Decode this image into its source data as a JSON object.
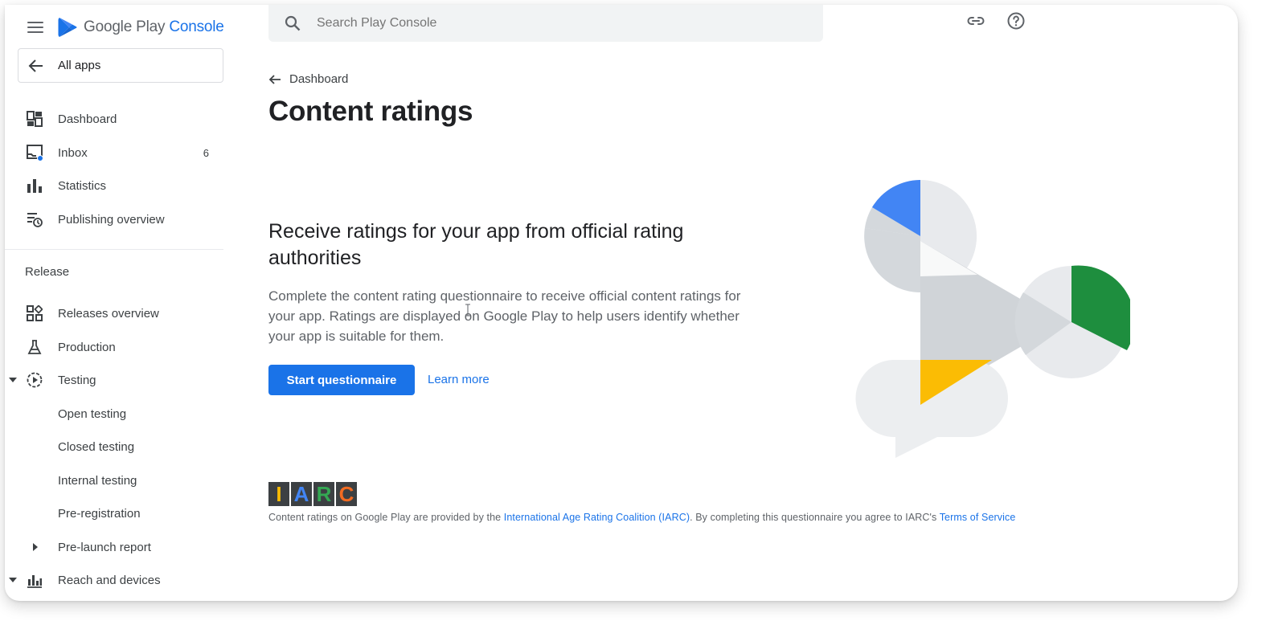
{
  "header": {
    "brand_google_play": "Google Play",
    "brand_console": "Console",
    "search_placeholder": "Search Play Console"
  },
  "sidebar": {
    "all_apps": "All apps",
    "items": [
      {
        "label": "Dashboard",
        "icon": "dashboard-icon"
      },
      {
        "label": "Inbox",
        "icon": "inbox-icon",
        "count": "6"
      },
      {
        "label": "Statistics",
        "icon": "statistics-icon"
      },
      {
        "label": "Publishing overview",
        "icon": "publishing-overview-icon"
      }
    ],
    "release_section": "Release",
    "release_items": [
      {
        "label": "Releases overview",
        "icon": "releases-overview-icon"
      },
      {
        "label": "Production",
        "icon": "production-icon"
      },
      {
        "label": "Testing",
        "icon": "testing-icon"
      },
      {
        "label": "Open testing"
      },
      {
        "label": "Closed testing"
      },
      {
        "label": "Internal testing"
      },
      {
        "label": "Pre-registration"
      },
      {
        "label": "Pre-launch report"
      },
      {
        "label": "Reach and devices",
        "icon": "reach-devices-icon"
      }
    ]
  },
  "main": {
    "back_label": "Dashboard",
    "page_title": "Content ratings",
    "hero_title": "Receive ratings for your app from official rating authorities",
    "hero_desc": "Complete the content rating questionnaire to receive official content ratings for your app. Ratings are displayed on Google Play to help users identify whether your app is suitable for them.",
    "start_button": "Start questionnaire",
    "learn_more": "Learn more",
    "iarc_letters": [
      "I",
      "A",
      "R",
      "C"
    ],
    "footer_prefix": "Content ratings on Google Play are provided by the ",
    "footer_link1": "International Age Rating Coalition (IARC)",
    "footer_middle": ". By completing this questionnaire you agree to IARC's ",
    "footer_link2": "Terms of Service"
  },
  "colors": {
    "accent": "#1a73e8",
    "green": "#1e8e3e",
    "yellow": "#fbbc04",
    "iarc_i": "#fbbc04",
    "iarc_a": "#4285f4",
    "iarc_r": "#34a853",
    "iarc_c": "#f26b21"
  }
}
